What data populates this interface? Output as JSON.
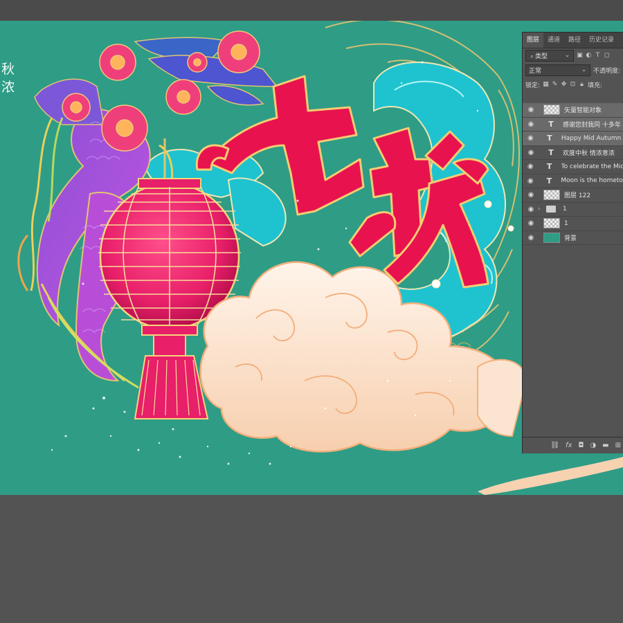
{
  "artwork": {
    "left_text_line1": "秋",
    "left_text_line2": "浓",
    "headline": "中秋",
    "colors": {
      "background": "#2f9c86",
      "headline": "#e8134e",
      "lantern": "#e81f69",
      "cloud": "#fbe5d2",
      "wave": "#1ec3cf"
    }
  },
  "layers_panel": {
    "tabs": [
      "图层",
      "通道",
      "路径",
      "历史记录"
    ],
    "filter_label": "类型",
    "blend_mode": "正常",
    "opacity_label": "不透明度:",
    "lock_label": "锁定:",
    "fill_label": "填充:",
    "layers": [
      {
        "name": "矢量智能对象",
        "kind": "smart",
        "highlighted": true
      },
      {
        "name": "感谢您封我同 十多年",
        "kind": "text",
        "highlighted": true
      },
      {
        "name": "Happy Mid Autumn Fe",
        "kind": "text",
        "highlighted": true
      },
      {
        "name": "欢度中秋 情浓意浓",
        "kind": "text",
        "highlighted": false
      },
      {
        "name": "To celebrate the Mid-A",
        "kind": "text",
        "highlighted": false
      },
      {
        "name": "Moon is the hometown",
        "kind": "text",
        "highlighted": false
      },
      {
        "name": "图层 122",
        "kind": "raster",
        "highlighted": false
      },
      {
        "name": "1",
        "kind": "group",
        "highlighted": false
      },
      {
        "name": "1",
        "kind": "raster",
        "highlighted": false
      },
      {
        "name": "背景",
        "kind": "background",
        "highlighted": false
      }
    ]
  }
}
